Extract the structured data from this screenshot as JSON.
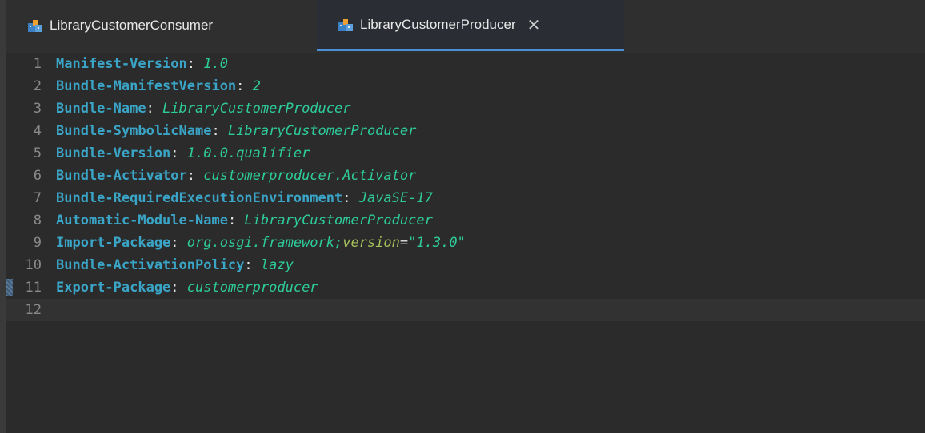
{
  "tabs": [
    {
      "label": "LibraryCustomerConsumer",
      "active": false,
      "icon": "plugin-manifest-icon"
    },
    {
      "label": "LibraryCustomerProducer",
      "active": true,
      "icon": "plugin-manifest-icon",
      "close": "✕"
    }
  ],
  "lines": [
    {
      "num": "1",
      "key": "Manifest-Version",
      "value": "1.0"
    },
    {
      "num": "2",
      "key": "Bundle-ManifestVersion",
      "value": "2"
    },
    {
      "num": "3",
      "key": "Bundle-Name",
      "value": "LibraryCustomerProducer"
    },
    {
      "num": "4",
      "key": "Bundle-SymbolicName",
      "value": "LibraryCustomerProducer"
    },
    {
      "num": "5",
      "key": "Bundle-Version",
      "value": "1.0.0.qualifier"
    },
    {
      "num": "6",
      "key": "Bundle-Activator",
      "value": "customerproducer.Activator"
    },
    {
      "num": "7",
      "key": "Bundle-RequiredExecutionEnvironment",
      "value": "JavaSE-17"
    },
    {
      "num": "8",
      "key": "Automatic-Module-Name",
      "value": "LibraryCustomerProducer"
    },
    {
      "num": "9",
      "key": "Import-Package",
      "value": "org.osgi.framework;",
      "attr": "version",
      "attr_value": "\"1.3.0\""
    },
    {
      "num": "10",
      "key": "Bundle-ActivationPolicy",
      "value": "lazy"
    },
    {
      "num": "11",
      "key": "Export-Package",
      "value": "customerproducer"
    },
    {
      "num": "12",
      "key": "",
      "value": ""
    }
  ],
  "colors": {
    "key": "#3aa5c7",
    "value": "#2ecc9a",
    "attr": "#a5c25c",
    "active_tab_underline": "#4a90d9"
  }
}
